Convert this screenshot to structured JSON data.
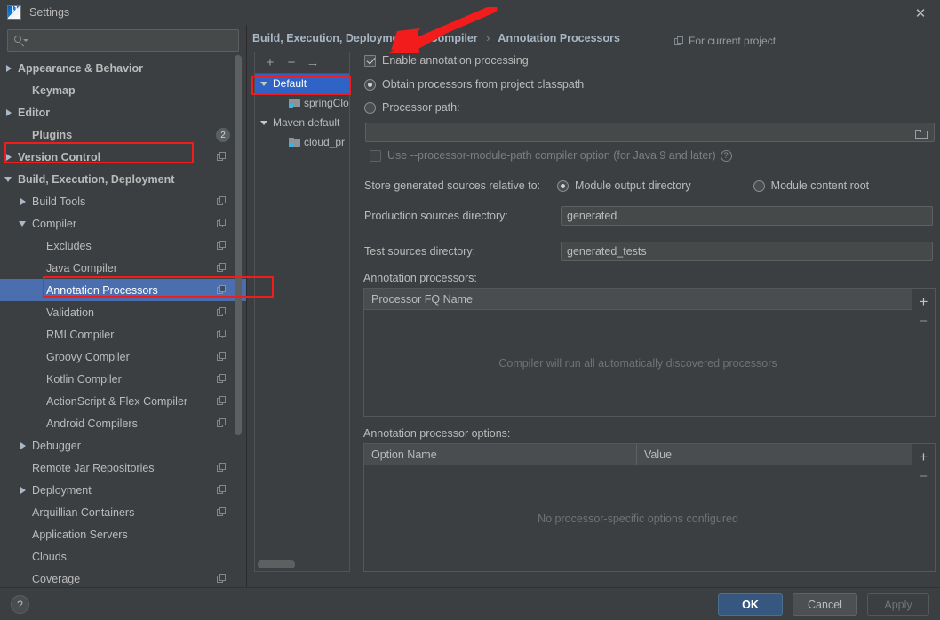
{
  "window": {
    "title": "Settings",
    "app_icon": "intellij-logo-icon",
    "close_icon": "close-icon"
  },
  "search": {
    "value": "",
    "placeholder": "",
    "icon": "search-icon"
  },
  "sidebar": {
    "items": [
      {
        "label": "Appearance & Behavior",
        "arrow": "right",
        "indent": 0,
        "bold": true,
        "copy": false,
        "badge": null,
        "selected": false
      },
      {
        "label": "Keymap",
        "arrow": "none",
        "indent": 1,
        "bold": true,
        "copy": false,
        "badge": null,
        "selected": false
      },
      {
        "label": "Editor",
        "arrow": "right",
        "indent": 0,
        "bold": true,
        "copy": false,
        "badge": null,
        "selected": false
      },
      {
        "label": "Plugins",
        "arrow": "none",
        "indent": 1,
        "bold": true,
        "copy": false,
        "badge": "2",
        "selected": false
      },
      {
        "label": "Version Control",
        "arrow": "right",
        "indent": 0,
        "bold": true,
        "copy": true,
        "badge": null,
        "selected": false
      },
      {
        "label": "Build, Execution, Deployment",
        "arrow": "down",
        "indent": 0,
        "bold": true,
        "copy": false,
        "badge": null,
        "selected": false
      },
      {
        "label": "Build Tools",
        "arrow": "right",
        "indent": 1,
        "bold": false,
        "copy": true,
        "badge": null,
        "selected": false
      },
      {
        "label": "Compiler",
        "arrow": "down",
        "indent": 1,
        "bold": false,
        "copy": true,
        "badge": null,
        "selected": false
      },
      {
        "label": "Excludes",
        "arrow": "none",
        "indent": 2,
        "bold": false,
        "copy": true,
        "badge": null,
        "selected": false
      },
      {
        "label": "Java Compiler",
        "arrow": "none",
        "indent": 2,
        "bold": false,
        "copy": true,
        "badge": null,
        "selected": false
      },
      {
        "label": "Annotation Processors",
        "arrow": "none",
        "indent": 2,
        "bold": false,
        "copy": true,
        "badge": null,
        "selected": true
      },
      {
        "label": "Validation",
        "arrow": "none",
        "indent": 2,
        "bold": false,
        "copy": true,
        "badge": null,
        "selected": false
      },
      {
        "label": "RMI Compiler",
        "arrow": "none",
        "indent": 2,
        "bold": false,
        "copy": true,
        "badge": null,
        "selected": false
      },
      {
        "label": "Groovy Compiler",
        "arrow": "none",
        "indent": 2,
        "bold": false,
        "copy": true,
        "badge": null,
        "selected": false
      },
      {
        "label": "Kotlin Compiler",
        "arrow": "none",
        "indent": 2,
        "bold": false,
        "copy": true,
        "badge": null,
        "selected": false
      },
      {
        "label": "ActionScript & Flex Compiler",
        "arrow": "none",
        "indent": 2,
        "bold": false,
        "copy": true,
        "badge": null,
        "selected": false
      },
      {
        "label": "Android Compilers",
        "arrow": "none",
        "indent": 2,
        "bold": false,
        "copy": true,
        "badge": null,
        "selected": false
      },
      {
        "label": "Debugger",
        "arrow": "right",
        "indent": 1,
        "bold": false,
        "copy": false,
        "badge": null,
        "selected": false
      },
      {
        "label": "Remote Jar Repositories",
        "arrow": "none",
        "indent": 1,
        "bold": false,
        "copy": true,
        "badge": null,
        "selected": false
      },
      {
        "label": "Deployment",
        "arrow": "right",
        "indent": 1,
        "bold": false,
        "copy": true,
        "badge": null,
        "selected": false
      },
      {
        "label": "Arquillian Containers",
        "arrow": "none",
        "indent": 1,
        "bold": false,
        "copy": true,
        "badge": null,
        "selected": false
      },
      {
        "label": "Application Servers",
        "arrow": "none",
        "indent": 1,
        "bold": false,
        "copy": false,
        "badge": null,
        "selected": false
      },
      {
        "label": "Clouds",
        "arrow": "none",
        "indent": 1,
        "bold": false,
        "copy": false,
        "badge": null,
        "selected": false
      },
      {
        "label": "Coverage",
        "arrow": "none",
        "indent": 1,
        "bold": false,
        "copy": true,
        "badge": null,
        "selected": false
      }
    ]
  },
  "profiles_panel": {
    "toolbar": {
      "add": "+",
      "remove": "−",
      "move": "→"
    },
    "items": [
      {
        "label": "Default",
        "arrow": "down",
        "module": false,
        "selected": true,
        "indent": 0
      },
      {
        "label": "springClo",
        "arrow": "none",
        "module": true,
        "selected": false,
        "indent": 1
      },
      {
        "label": "Maven default",
        "arrow": "down",
        "module": false,
        "selected": false,
        "indent": 0
      },
      {
        "label": "cloud_pr",
        "arrow": "none",
        "module": true,
        "selected": false,
        "indent": 1
      }
    ]
  },
  "breadcrumb": {
    "parts": [
      "Build, Execution, Deployment",
      "Compiler",
      "Annotation Processors"
    ],
    "separator": "›"
  },
  "scope": {
    "label": "For current project",
    "icon": "copy-icon"
  },
  "main": {
    "enable_annotation_processing": {
      "label": "Enable annotation processing",
      "checked": true
    },
    "processor_source": {
      "options": [
        {
          "label": "Obtain processors from project classpath",
          "selected": true
        },
        {
          "label": "Processor path:",
          "selected": false
        }
      ]
    },
    "processor_path": {
      "value": "",
      "browse_icon": "folder-icon"
    },
    "module_path_option": {
      "label": "Use --processor-module-path compiler option (for Java 9 and later)",
      "checked": false,
      "help_icon": "help-icon"
    },
    "store_relative": {
      "label": "Store generated sources relative to:",
      "options": [
        {
          "label": "Module output directory",
          "selected": true
        },
        {
          "label": "Module content root",
          "selected": false
        }
      ]
    },
    "production_sources": {
      "label": "Production sources directory:",
      "value": "generated"
    },
    "test_sources": {
      "label": "Test sources directory:",
      "value": "generated_tests"
    },
    "processors_table": {
      "title": "Annotation processors:",
      "columns": [
        "Processor FQ Name"
      ],
      "rows": [],
      "empty_text": "Compiler will run all automatically discovered processors",
      "add_label": "+",
      "remove_label": "−"
    },
    "options_table": {
      "title": "Annotation processor options:",
      "columns": [
        "Option Name",
        "Value"
      ],
      "rows": [],
      "empty_text": "No processor-specific options configured",
      "add_label": "+",
      "remove_label": "−"
    }
  },
  "footer": {
    "help_label": "?",
    "ok_label": "OK",
    "cancel_label": "Cancel",
    "apply_label": "Apply"
  },
  "annotations": {
    "accent_color": "#f31c1c",
    "highlight_color": "#4b6eaf",
    "primary_button_color": "#365880"
  }
}
